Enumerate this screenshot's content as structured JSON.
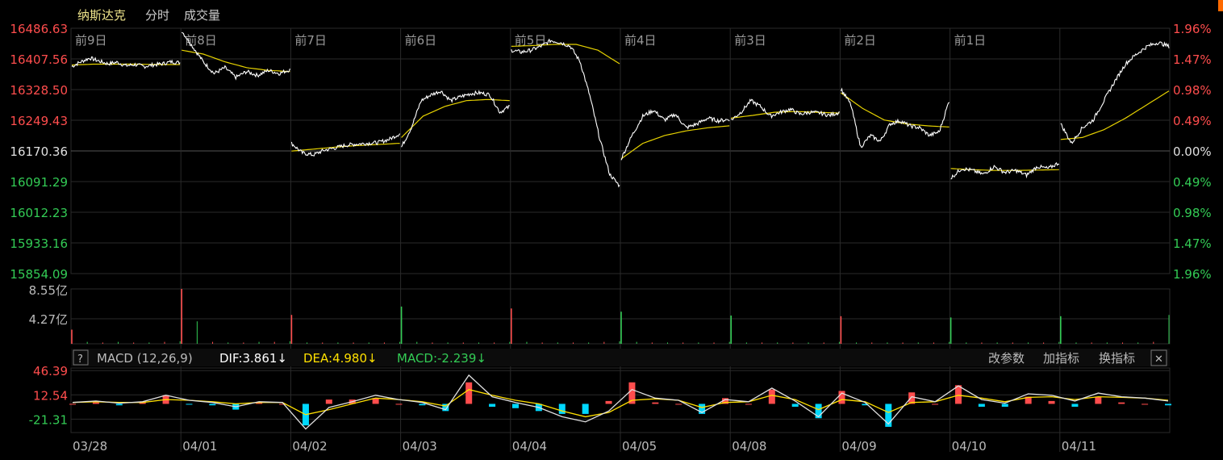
{
  "header": {
    "instrument": "纳斯达克",
    "tab_timeshare": "分时",
    "tab_volume": "成交量"
  },
  "colors": {
    "up": "#ff4d4d",
    "down": "#33cc55",
    "price_line": "#ffffff",
    "avg_line": "#e6d200",
    "dif_line": "#e0e0e0",
    "dea_line": "#ffe000",
    "macd_pos": "#ff4d4d",
    "macd_neg": "#00d8ff",
    "grid": "#2a2a2a",
    "axis_text": "#bbbbbb"
  },
  "chart_data": [
    {
      "type": "line",
      "pane": "price",
      "day_labels": [
        "前9日",
        "前8日",
        "前7日",
        "前6日",
        "前5日",
        "前4日",
        "前3日",
        "前2日",
        "前1日"
      ],
      "y_ticks_left": [
        "16486.63",
        "16407.56",
        "16328.50",
        "16249.43",
        "16170.36",
        "16091.29",
        "16012.23",
        "15933.16",
        "15854.09"
      ],
      "y_ticks_right": [
        "1.96%",
        "1.47%",
        "0.98%",
        "0.49%",
        "0.00%",
        "0.49%",
        "0.98%",
        "1.47%",
        "1.96%"
      ],
      "ylim": [
        15854.09,
        16486.63
      ],
      "reference_close": 16170.36,
      "series": [
        {
          "role": "price",
          "days": [
            [
              16388,
              16400,
              16410,
              16402,
              16395,
              16399,
              16390,
              16393,
              16388,
              16392,
              16395,
              16400,
              16398
            ],
            [
              16480,
              16440,
              16400,
              16370,
              16385,
              16360,
              16375,
              16365,
              16378,
              16370,
              16380
            ],
            [
              16190,
              16165,
              16160,
              16172,
              16178,
              16185,
              16188,
              16190,
              16192,
              16200,
              16215
            ],
            [
              16180,
              16230,
              16300,
              16315,
              16325,
              16300,
              16310,
              16318,
              16320,
              16315,
              16270,
              16285
            ],
            [
              16430,
              16425,
              16430,
              16440,
              16455,
              16450,
              16440,
              16400,
              16310,
              16200,
              16110,
              16080
            ],
            [
              16150,
              16210,
              16260,
              16275,
              16250,
              16265,
              16230,
              16240,
              16255,
              16248,
              16252
            ],
            [
              16250,
              16270,
              16300,
              16285,
              16260,
              16270,
              16278,
              16265,
              16270,
              16268,
              16262,
              16270
            ],
            [
              16330,
              16290,
              16180,
              16210,
              16195,
              16240,
              16248,
              16235,
              16230,
              16210,
              16220,
              16300
            ],
            [
              16100,
              16125,
              16120,
              16110,
              16130,
              16115,
              16120,
              16108,
              16130,
              16125,
              16140
            ],
            [
              16240,
              16190,
              16230,
              16250,
              16300,
              16350,
              16395,
              16420,
              16440,
              16450,
              16440
            ]
          ]
        },
        {
          "role": "average",
          "days": [
            [
              16392,
              16394,
              16394,
              16394,
              16393,
              16393
            ],
            [
              16430,
              16420,
              16400,
              16385,
              16378,
              16375
            ],
            [
              16170,
              16175,
              16180,
              16184,
              16187,
              16190
            ],
            [
              16205,
              16260,
              16285,
              16300,
              16303,
              16300
            ],
            [
              16440,
              16442,
              16445,
              16445,
              16430,
              16395
            ],
            [
              16150,
              16190,
              16210,
              16222,
              16230,
              16235
            ],
            [
              16255,
              16262,
              16270,
              16272,
              16270,
              16268
            ],
            [
              16320,
              16280,
              16250,
              16240,
              16235,
              16232
            ],
            [
              16125,
              16122,
              16120,
              16120,
              16121,
              16122
            ],
            [
              16200,
              16205,
              16225,
              16255,
              16290,
              16325
            ]
          ]
        }
      ]
    },
    {
      "type": "bar",
      "pane": "volume",
      "y_ticks": [
        "8.55亿",
        "4.27亿"
      ],
      "ylim": [
        0,
        8.55
      ],
      "day_volumes": [
        [
          2.2,
          0.3,
          0.2,
          0.3,
          0.2,
          0.2,
          0.3,
          0.4
        ],
        [
          8.55,
          3.5,
          0.3,
          0.2,
          0.2,
          0.3,
          0.3,
          0.4
        ],
        [
          4.5,
          0.2,
          0.2,
          0.2,
          0.2,
          0.2,
          0.2,
          0.3
        ],
        [
          5.8,
          0.3,
          0.2,
          0.2,
          0.2,
          0.2,
          0.2,
          0.3
        ],
        [
          5.5,
          0.3,
          0.2,
          0.2,
          0.2,
          0.2,
          0.3,
          0.4
        ],
        [
          5.0,
          0.3,
          0.2,
          0.2,
          0.2,
          0.2,
          0.2,
          0.3
        ],
        [
          4.4,
          0.2,
          0.2,
          0.2,
          0.2,
          0.2,
          0.2,
          0.3
        ],
        [
          4.3,
          0.2,
          0.2,
          0.2,
          0.2,
          0.2,
          0.2,
          0.3
        ],
        [
          4.1,
          0.2,
          0.2,
          0.2,
          0.2,
          0.2,
          0.2,
          0.3
        ],
        [
          4.3,
          0.2,
          0.2,
          0.2,
          0.2,
          0.2,
          0.3,
          4.5
        ]
      ],
      "day_up": [
        true,
        true,
        true,
        false,
        true,
        false,
        false,
        true,
        false,
        false
      ]
    },
    {
      "type": "line",
      "pane": "macd",
      "y_ticks": [
        "46.39",
        "12.54",
        "-21.31"
      ],
      "ylim": [
        -40,
        50
      ],
      "series": [
        {
          "name": "DIF",
          "values": [
            2,
            4,
            1,
            3,
            12,
            5,
            2,
            -4,
            3,
            2,
            -35,
            -5,
            3,
            12,
            6,
            2,
            -8,
            40,
            10,
            2,
            -5,
            -18,
            -25,
            -10,
            20,
            8,
            5,
            -12,
            6,
            3,
            22,
            4,
            -18,
            15,
            2,
            -28,
            10,
            3,
            25,
            6,
            1,
            14,
            12,
            4,
            15,
            10,
            8,
            4
          ]
        },
        {
          "name": "DEA",
          "values": [
            2,
            3,
            2,
            2,
            6,
            5,
            3,
            0,
            2,
            2,
            -15,
            -8,
            0,
            8,
            6,
            3,
            -3,
            20,
            12,
            5,
            0,
            -10,
            -18,
            -12,
            5,
            7,
            5,
            -5,
            2,
            3,
            12,
            6,
            -8,
            6,
            3,
            -12,
            2,
            3,
            12,
            8,
            3,
            9,
            10,
            6,
            10,
            9,
            8,
            5
          ]
        },
        {
          "name": "MACD",
          "values": [
            0,
            2,
            -2,
            2,
            12,
            -1,
            -2,
            -8,
            2,
            0,
            -30,
            6,
            6,
            8,
            0,
            -2,
            -10,
            30,
            -4,
            -6,
            -10,
            -14,
            -14,
            4,
            30,
            2,
            0,
            -14,
            8,
            0,
            20,
            -4,
            -20,
            18,
            -2,
            -32,
            16,
            0,
            26,
            -4,
            -4,
            10,
            4,
            -4,
            10,
            2,
            0,
            -2
          ]
        }
      ]
    }
  ],
  "macd_header": {
    "help": "?",
    "title": "MACD (12,26,9)",
    "dif": "DIF:3.861↓",
    "dea": "DEA:4.980↓",
    "macd": "MACD:-2.239↓",
    "btn_params": "改参数",
    "btn_add": "加指标",
    "btn_swap": "换指标",
    "btn_close": "✕"
  },
  "x_axis": {
    "dates": [
      "03/28",
      "04/01",
      "04/02",
      "04/03",
      "04/04",
      "04/05",
      "04/08",
      "04/09",
      "04/10",
      "04/11"
    ]
  }
}
